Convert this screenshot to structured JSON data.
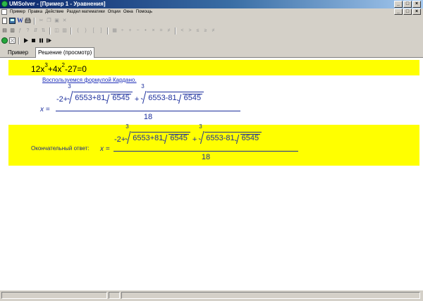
{
  "window": {
    "title": "UMSolver - [Пример 1 - Уравнения]",
    "min_icon": "_",
    "max_icon": "□",
    "close_icon": "×"
  },
  "menu": {
    "items": [
      "Пример",
      "Правка",
      "Действие",
      "Раздел математики",
      "Опции",
      "Окна",
      "Помощь"
    ]
  },
  "toolbar": {
    "row1_icons": [
      "new-doc-icon",
      "image-icon",
      "word-icon",
      "print-icon",
      "cut-icon",
      "copy-icon",
      "paste-icon",
      "delete-icon"
    ],
    "row2_glyphs": [
      "▤",
      "▥",
      "ƒ",
      "?",
      "⇵",
      "⇅",
      "◫",
      "▥",
      "(",
      ")",
      "[",
      "]",
      "▦",
      "÷",
      "+",
      "−",
      "•",
      "×",
      "=",
      "≠",
      "<",
      ">",
      "≤",
      "≥",
      "≠"
    ],
    "row3_icons": [
      "run-icon",
      "stop-icon",
      "play-icon",
      "stop-square-icon",
      "pause-icon",
      "step-icon"
    ]
  },
  "tabs": [
    {
      "label": "Пример"
    },
    {
      "label": "Решение (просмотр)"
    }
  ],
  "solution": {
    "equation": {
      "coef1": "12x",
      "exp1": "3",
      "mid": "+4x",
      "exp2": "2",
      "rest": "-27=0"
    },
    "cardano_link": "Воспользуемся формулой Кардано.",
    "formula": {
      "x_label": "x =",
      "prefix": "-2+",
      "plus": "+",
      "root_index": "3",
      "radicand1_a": "6553+81",
      "radicand1_sqrt": "6545",
      "radicand2_a": "6553-81",
      "radicand2_sqrt": "6545",
      "denominator": "18"
    },
    "answer_label": "Окончательный ответ:"
  },
  "colors": {
    "highlight": "#ffff00",
    "formula_text": "#1a2d9c",
    "link": "#2030b8",
    "chrome": "#d4d0c8"
  }
}
